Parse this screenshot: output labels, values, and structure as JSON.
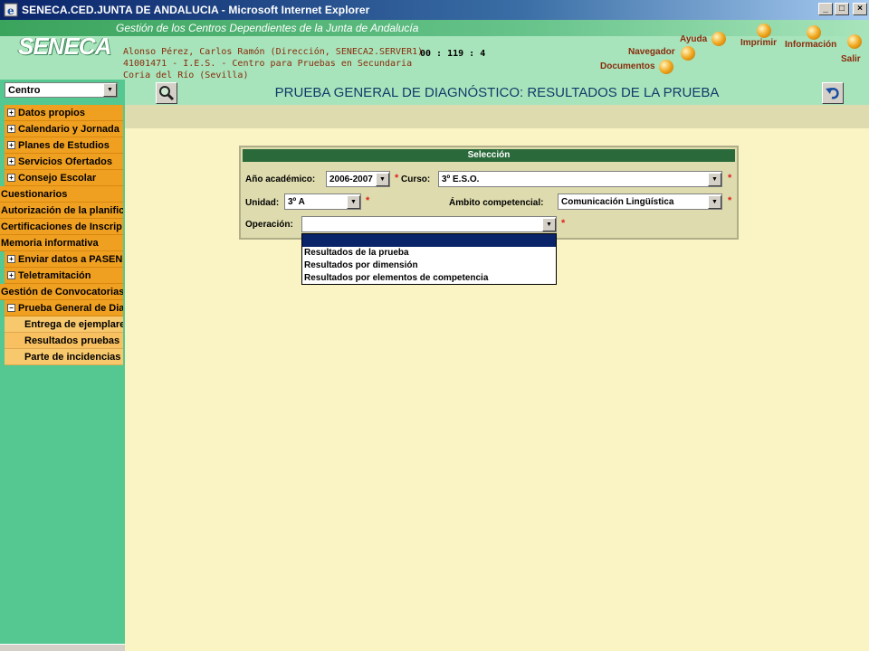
{
  "window": {
    "title": "SENECA.CED.JUNTA DE ANDALUCIA - Microsoft Internet Explorer",
    "min_label": "_",
    "max_label": "□",
    "close_label": "×"
  },
  "header": {
    "logo": "SENECA",
    "gestion": "Gestión de los Centros Dependientes de  la Junta de Andalucía",
    "user_line": "Alonso Pérez, Carlos Ramón (Dirección, SENECA2.SERVER1)",
    "center_line": "41001471 - I.E.S. - Centro para Pruebas en Secundaria",
    "town_line": "Coria del Río (Sevilla)",
    "clock": "00 : 119 : 4",
    "links": {
      "ayuda": "Ayuda",
      "imprimir": "Imprimir",
      "informacion": "Información",
      "navegador": "Navegador",
      "documentos": "Documentos",
      "salir": "Salir"
    }
  },
  "sidebar": {
    "centro": "Centro",
    "items": [
      {
        "label": "Datos propios",
        "pm": "+"
      },
      {
        "label": "Calendario y Jornada",
        "pm": "+"
      },
      {
        "label": "Planes de Estudios",
        "pm": "+"
      },
      {
        "label": "Servicios Ofertados",
        "pm": "+"
      },
      {
        "label": "Consejo Escolar",
        "pm": "+"
      },
      {
        "label": "Cuestionarios"
      },
      {
        "label": "Autorización de la planific"
      },
      {
        "label": "Certificaciones de Inscrip"
      },
      {
        "label": "Memoria informativa"
      },
      {
        "label": "Enviar datos a PASEN",
        "pm": "+"
      },
      {
        "label": "Teletramitación",
        "pm": "+"
      },
      {
        "label": "Gestión de Convocatorias"
      },
      {
        "label": "Prueba General de Diag",
        "pm": "−"
      },
      {
        "label": "Entrega de ejemplare"
      },
      {
        "label": "Resultados pruebas"
      },
      {
        "label": "Parte de incidencias"
      }
    ]
  },
  "main": {
    "title": "PRUEBA GENERAL DE DIAGNÓSTICO: RESULTADOS DE LA PRUEBA"
  },
  "form": {
    "panel_title": "Selección",
    "anio_label": "Año académico:",
    "anio_value": "2006-2007",
    "curso_label": "Curso:",
    "curso_value": "3º E.S.O.",
    "unidad_label": "Unidad:",
    "unidad_value": "3º A",
    "ambito_label": "Ámbito competencial:",
    "ambito_value": "Comunicación Lingüística",
    "operacion_label": "Operación:",
    "operacion_value": "",
    "required_mark": "*"
  },
  "operacion_options": [
    "",
    "Resultados de la prueba",
    "Resultados por dimensión",
    "Resultados por elementos de competencia"
  ]
}
